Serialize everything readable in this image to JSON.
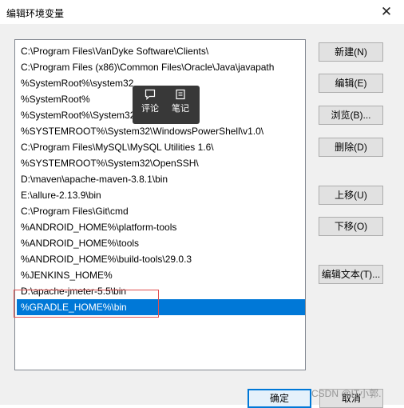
{
  "window": {
    "title": "编辑环境变量",
    "close_glyph": "✕"
  },
  "paths": [
    "C:\\Program Files\\VanDyke Software\\Clients\\",
    "C:\\Program Files (x86)\\Common Files\\Oracle\\Java\\javapath",
    "%SystemRoot%\\system32",
    "%SystemRoot%",
    "%SystemRoot%\\System32\\Wbem",
    "%SYSTEMROOT%\\System32\\WindowsPowerShell\\v1.0\\",
    "C:\\Program Files\\MySQL\\MySQL Utilities 1.6\\",
    "%SYSTEMROOT%\\System32\\OpenSSH\\",
    "D:\\maven\\apache-maven-3.8.1\\bin",
    "E:\\allure-2.13.9\\bin",
    "C:\\Program Files\\Git\\cmd",
    "%ANDROID_HOME%\\platform-tools",
    "%ANDROID_HOME%\\tools",
    "%ANDROID_HOME%\\build-tools\\29.0.3",
    "%JENKINS_HOME%",
    "D:\\apache-jmeter-5.5\\bin",
    "%GRADLE_HOME%\\bin"
  ],
  "selected_index": 16,
  "buttons": {
    "new": "新建(N)",
    "edit": "编辑(E)",
    "browse": "浏览(B)...",
    "delete": "删除(D)",
    "move_up": "上移(U)",
    "move_down": "下移(O)",
    "edit_text": "编辑文本(T)..."
  },
  "popover": {
    "comment_label": "评论",
    "note_label": "笔记"
  },
  "footer": {
    "ok": "确定",
    "cancel": "取消"
  },
  "watermark": "CSDN @IT小郭.",
  "colors": {
    "selection": "#0078d7",
    "highlight_box": "#e05050",
    "popover_bg": "#383838"
  }
}
